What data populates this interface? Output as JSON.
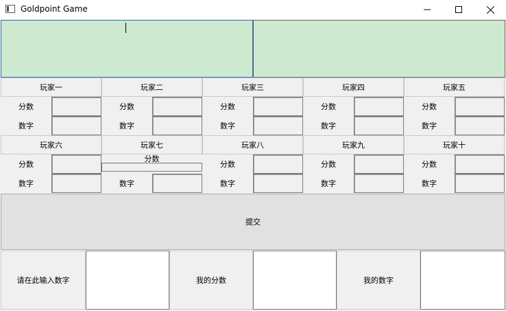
{
  "window": {
    "title": "Goldpoint Game",
    "controls": {
      "minimize": "—",
      "maximize": "☐",
      "close": "✕"
    }
  },
  "labels": {
    "score": "分数",
    "number": "数字"
  },
  "players_row1": [
    "玩家一",
    "玩家二",
    "玩家三",
    "玩家四",
    "玩家五"
  ],
  "players_row2": [
    "玩家六",
    "玩家七",
    "玩家八",
    "玩家九",
    "玩家十"
  ],
  "submit_label": "提交",
  "bottom": {
    "input_prompt": "请在此输入数字",
    "my_score": "我的分数",
    "my_number": "我的数字"
  }
}
